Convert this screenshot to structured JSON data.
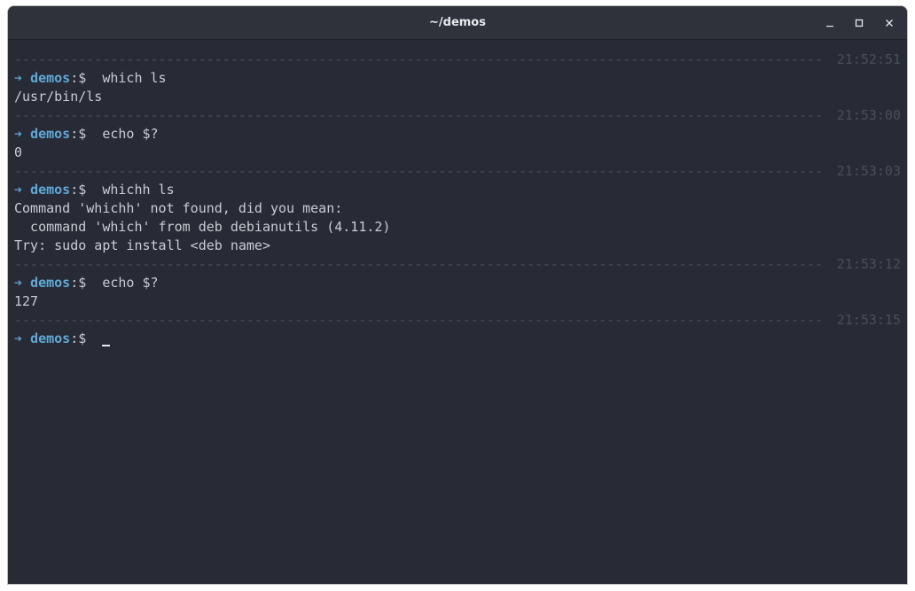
{
  "window": {
    "title": "~/demos",
    "controls": {
      "minimize": "minimize-icon",
      "maximize": "maximize-icon",
      "close": "close-icon"
    }
  },
  "terminal": {
    "colors": {
      "background": "#282b36",
      "accent": "#5fa9d8",
      "separator": "#4a4e5a",
      "text": "#c9ccd3"
    },
    "separator_dashes": "-----------------------------------------------------------------------------------------------------------------------",
    "prompt": {
      "arrow": "➔",
      "cwd": "demos",
      "symbol": ":$"
    },
    "blocks": [
      {
        "timestamp": "21:52:51",
        "command": "which ls",
        "output": [
          "/usr/bin/ls"
        ]
      },
      {
        "timestamp": "21:53:00",
        "command": "echo $?",
        "output": [
          "0"
        ]
      },
      {
        "timestamp": "21:53:03",
        "command": "whichh ls",
        "output": [
          "Command 'whichh' not found, did you mean:",
          "  command 'which' from deb debianutils (4.11.2)",
          "Try: sudo apt install <deb name>"
        ]
      },
      {
        "timestamp": "21:53:12",
        "command": "echo $?",
        "output": [
          "127"
        ]
      },
      {
        "timestamp": "21:53:15",
        "command": "",
        "output": []
      }
    ]
  }
}
